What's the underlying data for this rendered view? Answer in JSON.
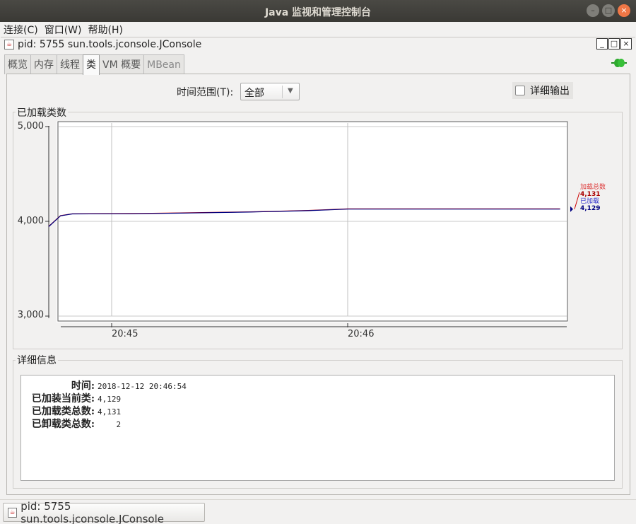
{
  "window": {
    "title": "Java 监视和管理控制台"
  },
  "menu": [
    "连接(C)",
    "窗口(W)",
    "帮助(H)"
  ],
  "inner": {
    "title": "pid: 5755 sun.tools.jconsole.JConsole"
  },
  "tabs": [
    {
      "label": "概览",
      "state": "normal"
    },
    {
      "label": "内存",
      "state": "normal"
    },
    {
      "label": "线程",
      "state": "normal"
    },
    {
      "label": "类",
      "state": "active"
    },
    {
      "label": "VM 概要",
      "state": "normal"
    },
    {
      "label": "MBean",
      "state": "disabled"
    }
  ],
  "controls": {
    "range_label": "时间范围(T):",
    "range_value": "全部",
    "detail_output_label": "详细输出",
    "detail_output_checked": false
  },
  "chart_section": {
    "label": "已加载类数"
  },
  "chart_data": {
    "type": "line",
    "y_ticks": [
      "3,000",
      "4,000",
      "5,000"
    ],
    "ylim": [
      3000,
      5000
    ],
    "x_ticks": [
      "20:45",
      "20:46"
    ],
    "grid": true,
    "series": [
      {
        "name": "加载总数",
        "color": "#cc0000",
        "x": [
          "20:44:44",
          "20:44:47",
          "20:44:50",
          "20:45:05",
          "20:45:20",
          "20:45:35",
          "20:45:50",
          "20:46:00",
          "20:46:54"
        ],
        "values": [
          3946,
          4060,
          4080,
          4082,
          4090,
          4100,
          4115,
          4131,
          4131
        ]
      },
      {
        "name": "已加载",
        "color": "#000080",
        "x": [
          "20:44:44",
          "20:44:47",
          "20:44:50",
          "20:45:05",
          "20:45:20",
          "20:45:35",
          "20:45:50",
          "20:46:00",
          "20:46:54"
        ],
        "values": [
          3944,
          4058,
          4078,
          4080,
          4088,
          4098,
          4113,
          4129,
          4129
        ]
      }
    ],
    "legend": {
      "total_label": "加载总数",
      "total_value": "4,131",
      "loaded_label": "已加载",
      "loaded_value": "4,129",
      "placement": "right"
    }
  },
  "details": {
    "label": "详细信息",
    "rows": [
      {
        "key": "时间:",
        "value": "2018-12-12 20:46:54"
      },
      {
        "key": "已加装当前类:",
        "value": "4,129"
      },
      {
        "key": "已加载类总数:",
        "value": "4,131"
      },
      {
        "key": "已卸载类总数:",
        "value": "    2"
      }
    ]
  },
  "taskbar": {
    "label": "pid: 5755 sun.tools.jconsole.JConsole"
  },
  "colors": {
    "titlebar": "#3c3b37",
    "close": "#f07746",
    "series_total": "#cc0000",
    "series_loaded": "#000080",
    "connection": "#2eaa2e"
  }
}
